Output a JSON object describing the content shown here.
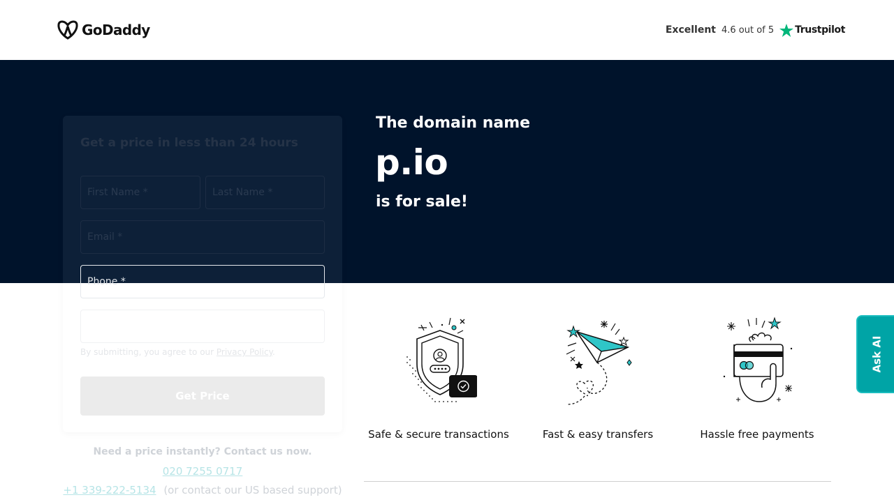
{
  "header": {
    "brand": "GoDaddy",
    "trustpilot": {
      "rating_word": "Excellent",
      "score": "4.6 out of 5",
      "brand": "Trustpilot"
    }
  },
  "hero": {
    "label": "The domain name",
    "domain": "p.io",
    "sale_text": "is for sale!"
  },
  "form": {
    "title": "Get a price in less than 24 hours",
    "first_name_placeholder": "First Name *",
    "last_name_placeholder": "Last Name *",
    "email_placeholder": "Email *",
    "phone_placeholder": "Phone *",
    "terms_text": "By submitting, you agree to our ",
    "privacy_link": "Privacy Policy",
    "terms_end": ".",
    "submit_label": "Get Price"
  },
  "contact": {
    "question": "Need a price instantly? Contact us now.",
    "phone_uk": "020 7255 0717",
    "phone_us": "+1 339-222-5134",
    "us_note": "(or contact our US based support)"
  },
  "features": [
    {
      "label": "Safe & secure transactions",
      "icon": "shield-icon"
    },
    {
      "label": "Fast & easy transfers",
      "icon": "paper-plane-icon"
    },
    {
      "label": "Hassle free payments",
      "icon": "credit-card-hand-icon"
    }
  ],
  "ask_ai": {
    "label": "Ask AI"
  },
  "colors": {
    "hero_bg": "#00132b",
    "accent_teal": "#00a4a6",
    "trustpilot_green": "#00b67a"
  }
}
